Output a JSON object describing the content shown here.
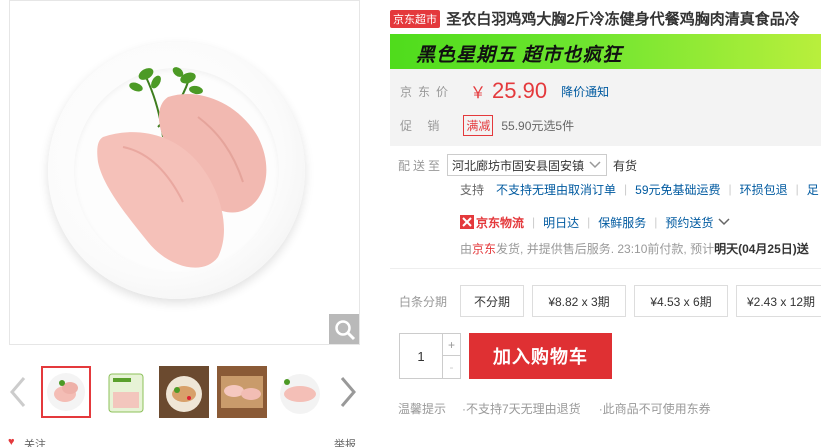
{
  "gallery": {
    "zoom_icon": "magnifier-icon",
    "thumbnails": [
      "chicken-on-plate",
      "chicken-package",
      "chicken-dish",
      "chicken-raw-board",
      "chicken-raw-plate"
    ],
    "bottom_left": "关注",
    "bottom_right": "举报"
  },
  "product": {
    "store_tag": "京东超市",
    "title": "圣农白羽鸡鸡大胸2斤冷冻健身代餐鸡胸肉清真食品冷"
  },
  "promo_banner": "黑色星期五  超市也疯狂",
  "price": {
    "label": "京东价",
    "currency": "￥",
    "value": "25.90",
    "notify": "降价通知"
  },
  "promotion": {
    "label": "促  销",
    "tag": "满减",
    "desc": "55.90元选5件"
  },
  "delivery": {
    "label": "配送至",
    "address": "河北廊坊市固安县固安镇",
    "stock": "有货",
    "support_label": "支持",
    "support_items": [
      "不支持无理由取消订单",
      "59元免基础运费",
      "环损包退",
      "足"
    ],
    "logistics_brand": "京东物流",
    "logistics_items": [
      "明日达",
      "保鲜服务",
      "预约送货"
    ],
    "ship_note_pre": "由 ",
    "ship_jd": "京东",
    "ship_note_mid": " 发货, 并提供售后服务. 23:10前付款, 预计",
    "ship_note_bold": "明天(04月25日)送"
  },
  "installment": {
    "label": "白条分期",
    "options": [
      "不分期",
      "¥8.82 x 3期",
      "¥4.53 x 6期",
      "¥2.43 x 12期"
    ]
  },
  "quantity": {
    "value": "1",
    "plus": "+",
    "minus": "-"
  },
  "cart_button": "加入购物车",
  "tips": {
    "label": "温馨提示",
    "items": [
      "·不支持7天无理由退货",
      "·此商品不可使用东券"
    ]
  },
  "colors": {
    "accent": "#e4393c",
    "link": "#005aa0",
    "promo_green": "#5ee024"
  }
}
